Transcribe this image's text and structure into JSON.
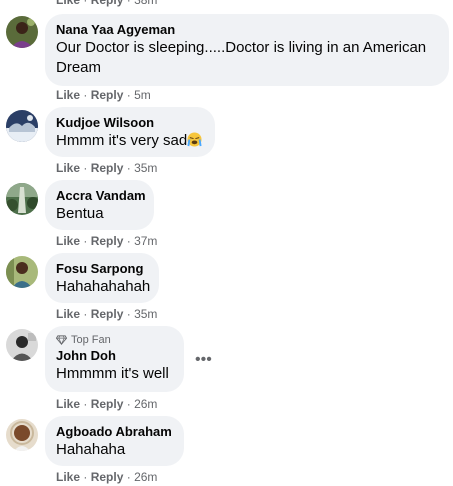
{
  "action_like": "Like",
  "action_reply": "Reply",
  "separator": "·",
  "top_truncated": {
    "time": "38m"
  },
  "comments": [
    {
      "author": "Nana Yaa Agyeman",
      "text": "Our Doctor is sleeping.....Doctor is living in an American Dream",
      "time": "5m"
    },
    {
      "author": "Kudjoe Wilsoon",
      "text": "Hmmm it's very sad",
      "emoji": "loudly-crying-face",
      "time": "35m"
    },
    {
      "author": "Accra Vandam",
      "text": "Bentua",
      "time": "37m"
    },
    {
      "author": "Fosu Sarpong",
      "text": "Hahahahahah",
      "time": "35m"
    },
    {
      "author": "John Doh",
      "badge": "Top Fan",
      "text": "Hmmmm it's well",
      "time": "26m",
      "more": "•••"
    },
    {
      "author": "Agboado Abraham",
      "text": "Hahahaha",
      "time": "26m"
    }
  ],
  "colors": {
    "bubble": "#f0f2f5",
    "secondary_text": "#65676b",
    "primary_text": "#050505"
  }
}
